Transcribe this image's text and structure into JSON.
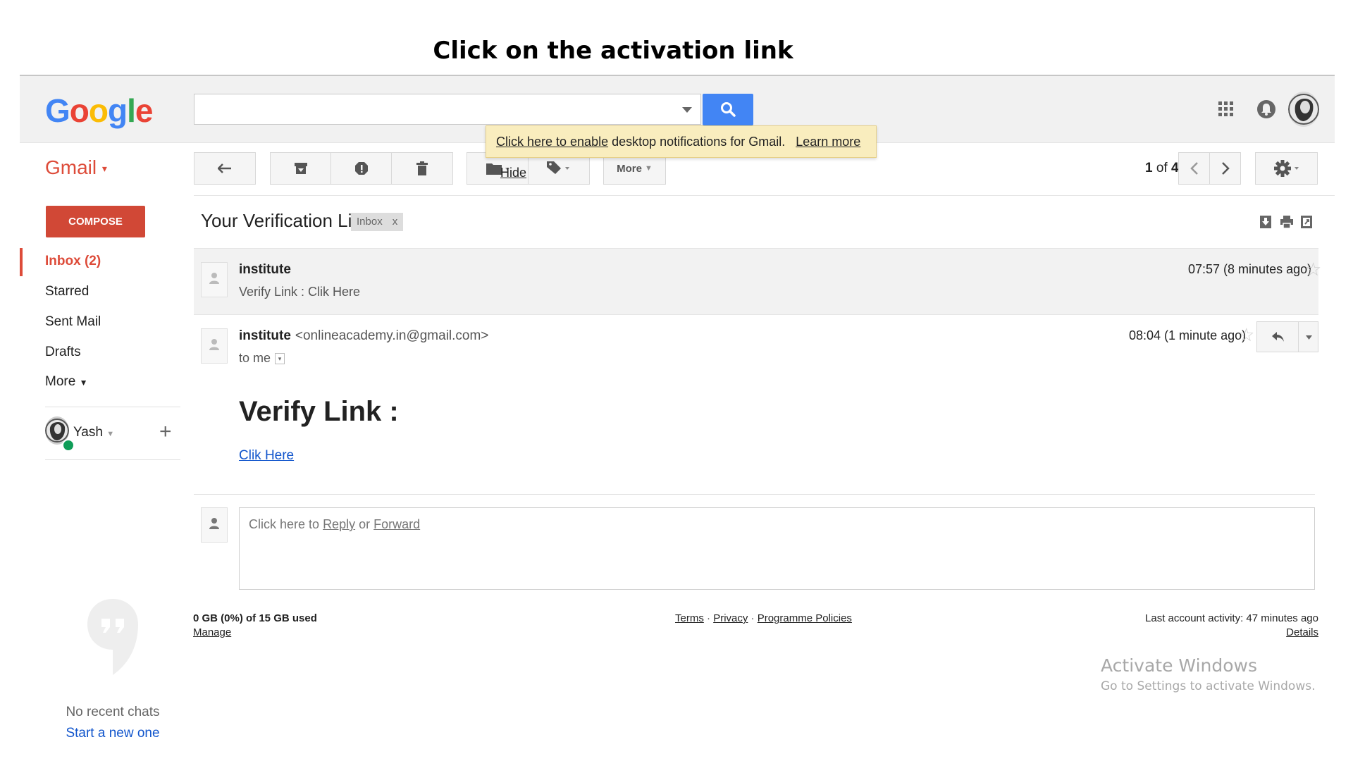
{
  "caption": "Click on the activation link",
  "header": {
    "logo_letters": [
      {
        "ch": "G",
        "color": "#4285f4"
      },
      {
        "ch": "o",
        "color": "#ea4335"
      },
      {
        "ch": "o",
        "color": "#fbbc05"
      },
      {
        "ch": "g",
        "color": "#4285f4"
      },
      {
        "ch": "l",
        "color": "#34a853"
      },
      {
        "ch": "e",
        "color": "#ea4335"
      }
    ],
    "search_value": "",
    "icons": [
      "search-icon",
      "apps-icon",
      "notifications-icon",
      "account-avatar"
    ]
  },
  "notification": {
    "enable_link": "Click here to enable",
    "text": "desktop notifications for Gmail.",
    "learn_more": "Learn more",
    "hide": "Hide"
  },
  "toolbar": {
    "app_label": "Gmail",
    "more_label": "More",
    "pager": {
      "current": "1",
      "of_text": "of",
      "total": "4"
    },
    "icons": [
      "back-icon",
      "archive-icon",
      "spam-icon",
      "delete-icon",
      "folder-icon",
      "label-icon",
      "chevron-left-icon",
      "chevron-right-icon",
      "settings-icon"
    ]
  },
  "sidebar": {
    "compose_label": "COMPOSE",
    "items": [
      {
        "label": "Inbox (2)",
        "active": true
      },
      {
        "label": "Starred",
        "active": false
      },
      {
        "label": "Sent Mail",
        "active": false
      },
      {
        "label": "Drafts",
        "active": false
      },
      {
        "label": "More",
        "active": false
      }
    ],
    "hangouts_user": "Yash",
    "no_chats": "No recent chats",
    "start_new": "Start a new one"
  },
  "thread": {
    "subject": "Your Verification Link",
    "label": "Inbox",
    "label_remove": "x",
    "messages": [
      {
        "sender": "institute",
        "snippet": "Verify Link : Clik Here",
        "time": "07:57 (8 minutes ago)"
      },
      {
        "sender": "institute",
        "email": "<onlineacademy.in@gmail.com>",
        "to": "to me",
        "time": "08:04 (1 minute ago)"
      }
    ],
    "body_heading": "Verify Link :",
    "body_link": "Clik Here",
    "reply_prompt": "Click here to",
    "reply_link": "Reply",
    "or_text": "or",
    "forward_link": "Forward"
  },
  "footer": {
    "storage": "0 GB (0%) of 15 GB used",
    "manage": "Manage",
    "terms": "Terms",
    "privacy": "Privacy",
    "policies": "Programme Policies",
    "sep": "·",
    "activity": "Last account activity: 47 minutes ago",
    "details": "Details"
  },
  "watermark": {
    "title": "Activate Windows",
    "subtitle": "Go to Settings to activate Windows."
  }
}
